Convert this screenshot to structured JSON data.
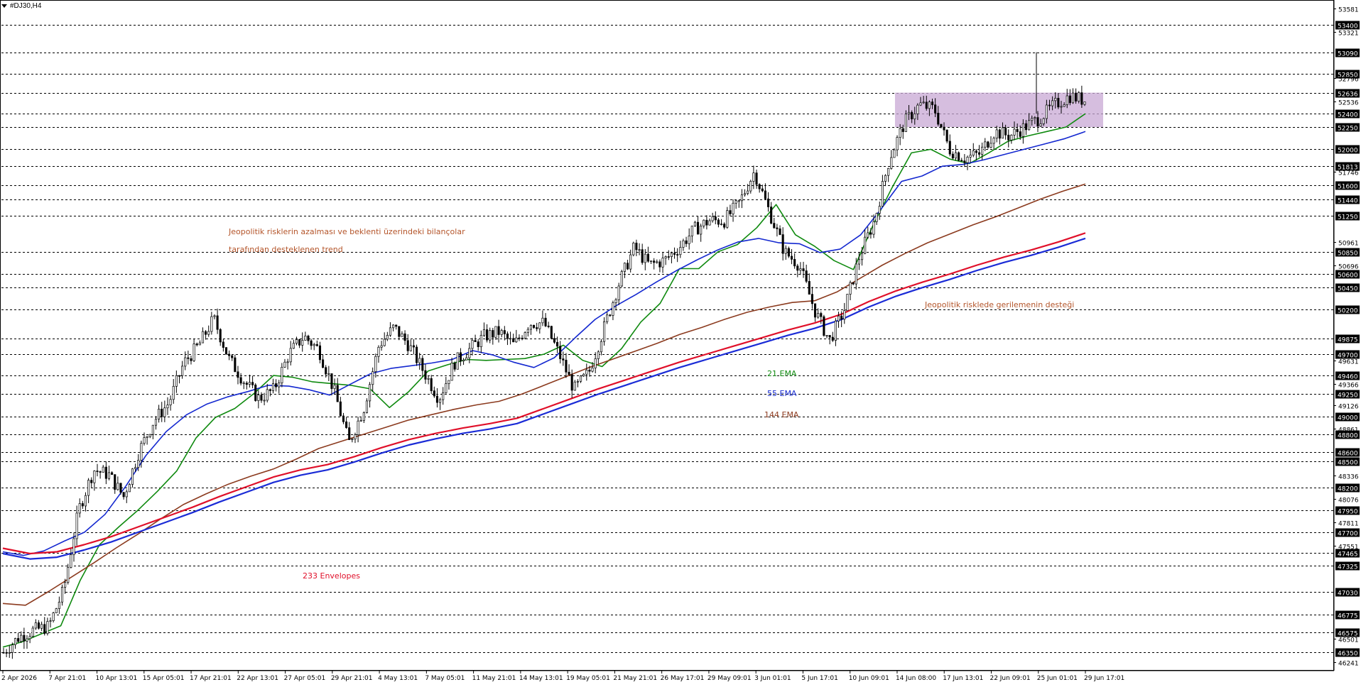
{
  "window": {
    "symbol_label": "#DJ30,H4"
  },
  "colors": {
    "ema21": "#0f8a0f",
    "ema55": "#1428d0",
    "ema144": "#8b3a1e",
    "env_upper": "#e0102a",
    "env_lower": "#1a2bd6",
    "candle": "#000000",
    "level_line": "#000000",
    "zone_fill": "#c8a8d4",
    "annotation_text": "#b4552a",
    "axis_badge_bg": "#000000",
    "axis_badge_text": "#ffffff"
  },
  "annotations": {
    "trend_line1": "Jeopolitik risklerin azalması ve beklenti üzerindeki bilançolar",
    "trend_line2": "tarafından desteklenen trend",
    "support_note": "Jeopolitik risklede gerilemenin desteği",
    "ema21_label": "21 EMA",
    "ema55_label": "55 EMA",
    "ema144_label": "144 EMA",
    "envelope_label": "233 Envelopes"
  },
  "chart_data": {
    "type": "candlestick",
    "symbol": "#DJ30",
    "timeframe": "H4",
    "ylim": [
      46241,
      53581
    ],
    "x_ticks": [
      "2 Apr 2026",
      "7 Apr 21:01",
      "10 Apr 13:01",
      "15 Apr 05:01",
      "17 Apr 21:01",
      "22 Apr 13:01",
      "27 Apr 05:01",
      "29 Apr 21:01",
      "4 May 13:01",
      "7 May 05:01",
      "11 May 21:01",
      "14 May 13:01",
      "19 May 05:01",
      "21 May 21:01",
      "26 May 17:01",
      "29 May 09:01",
      "3 Jun 01:01",
      "5 Jun 17:01",
      "10 Jun 09:01",
      "14 Jun 08:00",
      "17 Jun 13:01",
      "22 Jun 09:01",
      "25 Jun 01:01",
      "29 Jun 17:01"
    ],
    "level_lines": [
      53400,
      53090,
      52850,
      52636,
      52400,
      52250,
      52000,
      51813,
      51600,
      51440,
      51250,
      50850,
      50600,
      50450,
      50200,
      49875,
      49700,
      49460,
      49250,
      49000,
      48800,
      48600,
      48500,
      48200,
      47950,
      47700,
      47465,
      47325,
      47030,
      46775,
      46575,
      46350
    ],
    "axis_ticks_plain": [
      53581,
      53321,
      52796,
      52536,
      51746,
      50961,
      50696,
      49631,
      49366,
      49126,
      48861,
      48336,
      48076,
      47811,
      47551,
      46501,
      46241
    ],
    "consolidation_zone": {
      "from_x_label": "14 Jun 08:00",
      "to_x_label": "29 Jun 17:01",
      "y_top": 52636,
      "y_bottom": 52250
    },
    "series": [
      {
        "name": "21 EMA",
        "key": "ema21",
        "values": [
          46410,
          46470,
          46560,
          46650,
          47160,
          47560,
          47760,
          47950,
          48160,
          48390,
          48760,
          48990,
          49090,
          49260,
          49460,
          49440,
          49390,
          49370,
          49350,
          49310,
          49100,
          49280,
          49510,
          49580,
          49640,
          49630,
          49640,
          49650,
          49700,
          49800,
          49630,
          49560,
          49760,
          50060,
          50270,
          50660,
          50660,
          50850,
          50930,
          51120,
          51380,
          51040,
          50910,
          50750,
          50650,
          51140,
          51570,
          51960,
          52000,
          51890,
          51840,
          51960,
          52090,
          52150,
          52200,
          52250,
          52400
        ]
      },
      {
        "name": "55 EMA",
        "key": "ema55",
        "values": [
          47480,
          47440,
          47490,
          47600,
          47700,
          47900,
          48210,
          48560,
          48830,
          49020,
          49140,
          49220,
          49280,
          49350,
          49340,
          49300,
          49240,
          49360,
          49480,
          49540,
          49570,
          49600,
          49640,
          49740,
          49690,
          49610,
          49550,
          49660,
          49880,
          50090,
          50240,
          50370,
          50510,
          50640,
          50760,
          50870,
          50960,
          51000,
          50950,
          50940,
          50840,
          50880,
          51040,
          51330,
          51640,
          51700,
          51810,
          51830,
          51880,
          51940,
          52000,
          52060,
          52120,
          52200
        ]
      },
      {
        "name": "144 EMA",
        "key": "ema144",
        "values": [
          46900,
          46880,
          47030,
          47190,
          47350,
          47520,
          47680,
          47850,
          48010,
          48130,
          48240,
          48330,
          48410,
          48520,
          48640,
          48720,
          48800,
          48880,
          48960,
          49020,
          49080,
          49130,
          49170,
          49250,
          49350,
          49450,
          49550,
          49640,
          49730,
          49820,
          49920,
          50000,
          50090,
          50170,
          50230,
          50280,
          50300,
          50400,
          50550,
          50700,
          50830,
          50950,
          51050,
          51150,
          51240,
          51340,
          51440,
          51530,
          51610
        ]
      },
      {
        "name": "233 Envelopes",
        "key": "env_upper",
        "values": [
          47520,
          47460,
          47480,
          47560,
          47650,
          47760,
          47870,
          47980,
          48100,
          48210,
          48320,
          48400,
          48460,
          48550,
          48650,
          48740,
          48810,
          48870,
          48920,
          48980,
          49090,
          49200,
          49310,
          49410,
          49510,
          49610,
          49700,
          49790,
          49880,
          49970,
          50050,
          50150,
          50290,
          50410,
          50510,
          50600,
          50700,
          50790,
          50870,
          50960,
          51060
        ]
      },
      {
        "name": "233 Envelopes",
        "key": "env_lower",
        "values": [
          47460,
          47400,
          47420,
          47500,
          47590,
          47700,
          47810,
          47920,
          48040,
          48150,
          48260,
          48340,
          48400,
          48490,
          48590,
          48680,
          48750,
          48810,
          48860,
          48920,
          49030,
          49140,
          49250,
          49350,
          49450,
          49550,
          49640,
          49730,
          49820,
          49910,
          49990,
          50090,
          50230,
          50350,
          50450,
          50540,
          50640,
          50730,
          50810,
          50900,
          51000
        ]
      }
    ],
    "price_path": [
      46350,
      46520,
      46600,
      46640,
      47050,
      47950,
      48400,
      48350,
      48100,
      48600,
      48950,
      49150,
      49600,
      49800,
      50100,
      49650,
      49400,
      49200,
      49300,
      49700,
      49900,
      49750,
      49300,
      48700,
      49100,
      49800,
      50000,
      49800,
      49500,
      49200,
      49600,
      49750,
      49900,
      49950,
      49800,
      50050,
      50050,
      49700,
      49300,
      49500,
      50000,
      50500,
      50900,
      50700,
      50750,
      50900,
      51100,
      51200,
      51200,
      51400,
      51750,
      51300,
      50850,
      50700,
      50200,
      49850,
      50200,
      50800,
      51200,
      51900,
      52300,
      52500,
      52450,
      52000,
      51900,
      51950,
      52200,
      52150,
      52250,
      52350,
      52500,
      52600,
      52550
    ]
  }
}
